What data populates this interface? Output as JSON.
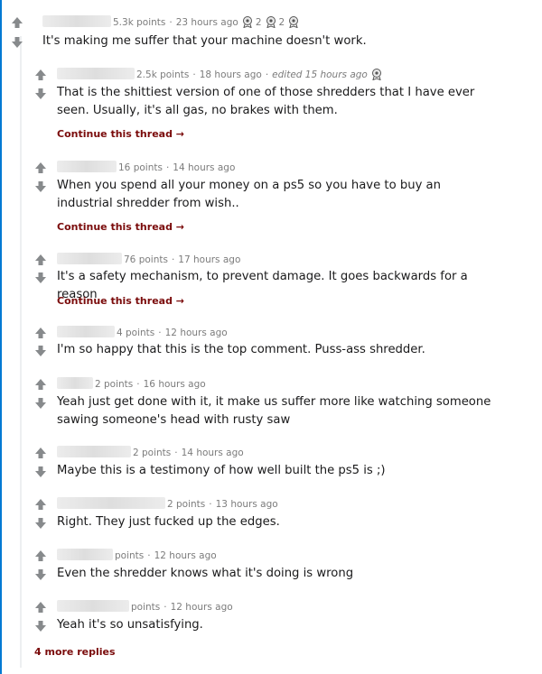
{
  "colors": {
    "accent": "#0079d3",
    "continue_link": "#7a0b0b",
    "meta_text": "#7c7c7c"
  },
  "icons": {
    "upvote": "up-arrow-icon",
    "downvote": "down-arrow-icon"
  },
  "top_comment": {
    "points": "5.3k points",
    "time": "23 hours ago",
    "awards": [
      {
        "icon": "award-icon",
        "count": "2"
      },
      {
        "icon": "award-icon",
        "count": "2"
      },
      {
        "icon": "award-icon",
        "count": ""
      }
    ],
    "body": "It's making me suffer that your machine doesn't work."
  },
  "replies": [
    {
      "points": "2.5k points",
      "time": "18 hours ago",
      "edited": "edited 15 hours ago",
      "body": "That is the shittiest version of one of those shredders that I have ever seen. Usually, it's all gas, no brakes with them.",
      "continue": "Continue this thread"
    },
    {
      "points": "16 points",
      "time": "14 hours ago",
      "body": "When you spend all your money on a ps5 so you have to buy an industrial shredder from wish..",
      "continue": "Continue this thread"
    },
    {
      "points": "76 points",
      "time": "17 hours ago",
      "body": "It's a safety mechanism, to prevent damage. It goes backwards for a reason",
      "continue": "Continue this thread"
    },
    {
      "points": "4 points",
      "time": "12 hours ago",
      "body": "I'm so happy that this is the top comment. Puss-ass shredder."
    },
    {
      "points": "2 points",
      "time": "16 hours ago",
      "body": "Yeah just get done with it, it make us suffer more like watching someone sawing someone's head with rusty saw"
    },
    {
      "points": "2 points",
      "time": "14 hours ago",
      "body": "Maybe this is a testimony of how well built the ps5 is ;)"
    },
    {
      "points": "2 points",
      "time": "13 hours ago",
      "body": "Right. They just fucked up the edges."
    },
    {
      "points": "points",
      "time": "12 hours ago",
      "body": "Even the shredder knows what it's doing is wrong"
    },
    {
      "points": "points",
      "time": "12 hours ago",
      "body": "Yeah it's so unsatisfying."
    }
  ],
  "more_replies": "4 more replies"
}
